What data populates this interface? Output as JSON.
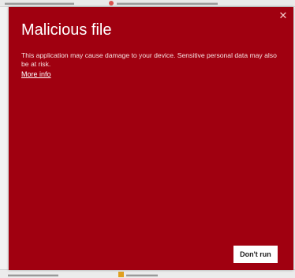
{
  "dialog": {
    "title": "Malicious file",
    "message": "This application may cause damage to your device. Sensitive personal data may also be at risk.",
    "more_info_label": "More info",
    "close_icon": "close-icon",
    "dont_run_label": "Don't run"
  },
  "colors": {
    "dialog_background": "#a00010",
    "button_background": "#ffffff"
  }
}
